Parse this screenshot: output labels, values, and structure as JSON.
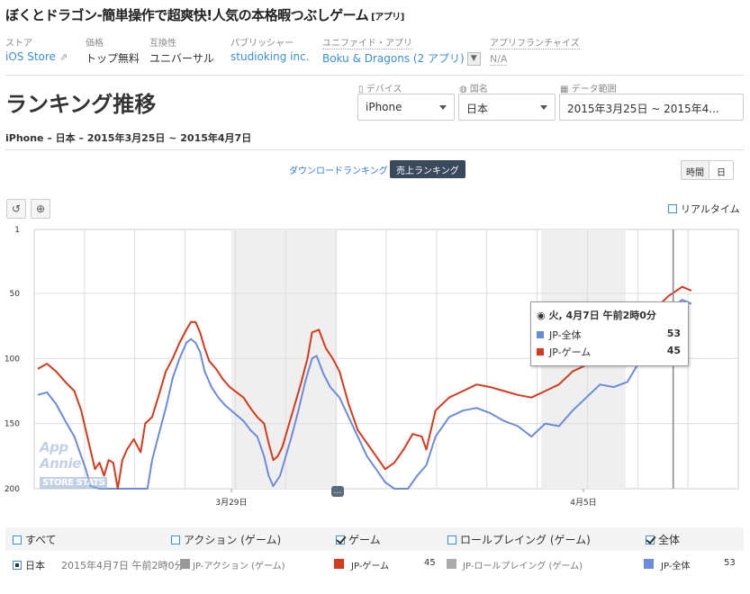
{
  "app": {
    "title": "ぼくとドラゴン-簡単操作で超爽快!人気の本格暇つぶしゲーム",
    "tag": "[アプリ]"
  },
  "meta": {
    "store_label": "ストア",
    "store_value": "iOS Store",
    "price_label": "価格",
    "price_value": "トップ無料",
    "compat_label": "互換性",
    "compat_value": "ユニバーサル",
    "publisher_label": "パブリッシャー",
    "publisher_value": "studioking inc.",
    "unified_label": "ユニファイド・アプリ",
    "unified_value": "Boku & Dragons (2 アプリ)",
    "franchise_label": "アプリフランチャイズ",
    "franchise_value": "N/A"
  },
  "page": {
    "heading": "ランキング推移",
    "subtitle": "iPhone – 日本 – 2015年3月25日 ~ 2015年4月7日"
  },
  "filters": {
    "device_label": "デバイス",
    "device_value": "iPhone",
    "country_label": "国名",
    "country_value": "日本",
    "range_label": "データ範囲",
    "range_value": "2015年3月25日 ~ 2015年4..."
  },
  "toolbar": {
    "download_ranking": "ダウンロードランキング",
    "sales_ranking": "売上ランキング",
    "hour": "時間",
    "day": "日",
    "realtime": "リアルタイム"
  },
  "tooltip": {
    "title": "火, 4月7日 午前2時0分",
    "rows": [
      {
        "label": "JP-全体",
        "value": "53"
      },
      {
        "label": "JP-ゲーム",
        "value": "45"
      }
    ]
  },
  "watermark": {
    "top": "App Annie",
    "bottom": "STORE STATS"
  },
  "legend": {
    "all": "すべて",
    "action": "アクション (ゲーム)",
    "game": "ゲーム",
    "roleplaying": "ロールプレイング (ゲーム)",
    "overall": "全体"
  },
  "bottom_row": {
    "country": "日本",
    "timestamp": "2015年4月7日 午前2時0分",
    "action_label": "JP-アクション (ゲーム)",
    "game_label": "JP-ゲーム",
    "game_value": "45",
    "rp_label": "JP-ロールプレイング (ゲーム)",
    "overall_label": "JP-全体",
    "overall_value": "53"
  },
  "colors": {
    "game_series": "#d43b1e",
    "overall_series": "#6b8cdc",
    "action_series": "#999999",
    "rp_series": "#aaaaaa",
    "accent": "#3d8fd3"
  },
  "chart_data": {
    "type": "line",
    "ylim": [
      200,
      1
    ],
    "yticks": [
      "1",
      "50",
      "100",
      "150",
      "200"
    ],
    "xtick_labels": [
      "3月29日",
      "4月5日"
    ],
    "x_range": [
      "2015-03-25",
      "2015-04-07"
    ],
    "series": [
      {
        "name": "JP-ゲーム",
        "values": [
          [
            0,
            108
          ],
          [
            0.04,
            104
          ],
          [
            0.08,
            110
          ],
          [
            0.12,
            118
          ],
          [
            0.16,
            125
          ],
          [
            0.19,
            140
          ],
          [
            0.21,
            155
          ],
          [
            0.23,
            170
          ],
          [
            0.25,
            185
          ],
          [
            0.27,
            180
          ],
          [
            0.29,
            190
          ],
          [
            0.31,
            178
          ],
          [
            0.33,
            180
          ],
          [
            0.35,
            200
          ],
          [
            0.37,
            178
          ],
          [
            0.39,
            170
          ],
          [
            0.42,
            162
          ],
          [
            0.45,
            172
          ],
          [
            0.47,
            150
          ],
          [
            0.5,
            145
          ],
          [
            0.53,
            128
          ],
          [
            0.56,
            110
          ],
          [
            0.59,
            100
          ],
          [
            0.62,
            88
          ],
          [
            0.65,
            78
          ],
          [
            0.67,
            72
          ],
          [
            0.69,
            72
          ],
          [
            0.71,
            80
          ],
          [
            0.73,
            92
          ],
          [
            0.75,
            102
          ],
          [
            0.78,
            108
          ],
          [
            0.81,
            116
          ],
          [
            0.84,
            122
          ],
          [
            0.87,
            126
          ],
          [
            0.9,
            130
          ],
          [
            0.93,
            138
          ],
          [
            0.96,
            145
          ],
          [
            0.99,
            150
          ],
          [
            1.01,
            165
          ],
          [
            1.03,
            178
          ],
          [
            1.05,
            175
          ],
          [
            1.07,
            168
          ],
          [
            1.1,
            150
          ],
          [
            1.12,
            138
          ],
          [
            1.15,
            120
          ],
          [
            1.18,
            100
          ],
          [
            1.2,
            80
          ],
          [
            1.23,
            78
          ],
          [
            1.26,
            92
          ],
          [
            1.29,
            100
          ],
          [
            1.32,
            110
          ],
          [
            1.36,
            135
          ],
          [
            1.4,
            155
          ],
          [
            1.44,
            165
          ],
          [
            1.48,
            175
          ],
          [
            1.52,
            185
          ],
          [
            1.56,
            180
          ],
          [
            1.6,
            170
          ],
          [
            1.64,
            158
          ],
          [
            1.68,
            160
          ],
          [
            1.7,
            170
          ],
          [
            1.74,
            140
          ],
          [
            1.8,
            130
          ],
          [
            1.86,
            125
          ],
          [
            1.92,
            120
          ],
          [
            1.98,
            122
          ],
          [
            2.04,
            125
          ],
          [
            2.1,
            128
          ],
          [
            2.16,
            130
          ],
          [
            2.22,
            125
          ],
          [
            2.28,
            120
          ],
          [
            2.34,
            110
          ],
          [
            2.4,
            105
          ],
          [
            2.46,
            100
          ],
          [
            2.52,
            98
          ],
          [
            2.58,
            90
          ],
          [
            2.64,
            78
          ],
          [
            2.7,
            62
          ],
          [
            2.76,
            52
          ],
          [
            2.82,
            45
          ],
          [
            2.86,
            48
          ]
        ]
      },
      {
        "name": "JP-全体",
        "values": [
          [
            0,
            128
          ],
          [
            0.04,
            126
          ],
          [
            0.08,
            135
          ],
          [
            0.12,
            148
          ],
          [
            0.16,
            160
          ],
          [
            0.19,
            175
          ],
          [
            0.21,
            185
          ],
          [
            0.23,
            198
          ],
          [
            0.27,
            200
          ],
          [
            0.31,
            200
          ],
          [
            0.36,
            200
          ],
          [
            0.4,
            200
          ],
          [
            0.44,
            200
          ],
          [
            0.48,
            200
          ],
          [
            0.5,
            178
          ],
          [
            0.53,
            158
          ],
          [
            0.56,
            138
          ],
          [
            0.59,
            115
          ],
          [
            0.62,
            100
          ],
          [
            0.65,
            88
          ],
          [
            0.67,
            85
          ],
          [
            0.69,
            88
          ],
          [
            0.71,
            95
          ],
          [
            0.73,
            110
          ],
          [
            0.76,
            122
          ],
          [
            0.79,
            130
          ],
          [
            0.82,
            136
          ],
          [
            0.86,
            142
          ],
          [
            0.9,
            148
          ],
          [
            0.93,
            155
          ],
          [
            0.96,
            160
          ],
          [
            0.99,
            175
          ],
          [
            1.01,
            190
          ],
          [
            1.03,
            198
          ],
          [
            1.06,
            190
          ],
          [
            1.09,
            172
          ],
          [
            1.11,
            160
          ],
          [
            1.14,
            140
          ],
          [
            1.17,
            118
          ],
          [
            1.2,
            100
          ],
          [
            1.22,
            98
          ],
          [
            1.25,
            112
          ],
          [
            1.28,
            122
          ],
          [
            1.32,
            130
          ],
          [
            1.36,
            145
          ],
          [
            1.4,
            160
          ],
          [
            1.44,
            175
          ],
          [
            1.48,
            185
          ],
          [
            1.52,
            195
          ],
          [
            1.56,
            200
          ],
          [
            1.62,
            200
          ],
          [
            1.66,
            190
          ],
          [
            1.7,
            182
          ],
          [
            1.74,
            160
          ],
          [
            1.8,
            145
          ],
          [
            1.86,
            140
          ],
          [
            1.92,
            138
          ],
          [
            1.98,
            142
          ],
          [
            2.04,
            148
          ],
          [
            2.1,
            152
          ],
          [
            2.16,
            160
          ],
          [
            2.22,
            150
          ],
          [
            2.28,
            152
          ],
          [
            2.34,
            140
          ],
          [
            2.4,
            130
          ],
          [
            2.46,
            120
          ],
          [
            2.52,
            122
          ],
          [
            2.58,
            118
          ],
          [
            2.64,
            100
          ],
          [
            2.7,
            82
          ],
          [
            2.76,
            62
          ],
          [
            2.82,
            55
          ],
          [
            2.86,
            58
          ]
        ]
      }
    ]
  }
}
